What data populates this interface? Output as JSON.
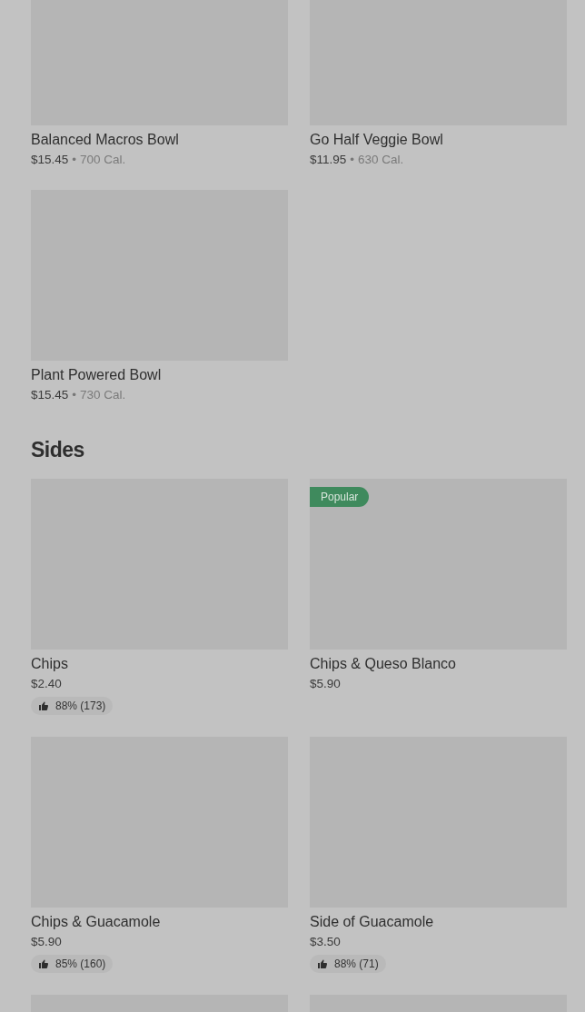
{
  "sections": [
    {
      "rows": [
        {
          "items": [
            {
              "kind": "item",
              "name": "Balanced Macros Bowl",
              "price": "$15.45",
              "separator": "•",
              "calories": "700 Cal."
            },
            {
              "kind": "item",
              "name": "Go Half Veggie Bowl",
              "price": "$11.95",
              "separator": "•",
              "calories": "630 Cal."
            }
          ]
        },
        {
          "items": [
            {
              "kind": "item",
              "name": "Plant Powered Bowl",
              "price": "$15.45",
              "separator": "•",
              "calories": "730 Cal."
            }
          ]
        }
      ]
    },
    {
      "title": "Sides",
      "rows": [
        {
          "items": [
            {
              "kind": "item",
              "name": "Chips",
              "price": "$2.40",
              "rating": "88% (173)"
            },
            {
              "kind": "item",
              "name": "Chips & Queso Blanco",
              "price": "$5.90",
              "badge": "Popular"
            }
          ]
        },
        {
          "items": [
            {
              "kind": "item",
              "name": "Chips & Guacamole",
              "price": "$5.90",
              "rating": "85% (160)"
            },
            {
              "kind": "item",
              "name": "Side of Guacamole",
              "price": "$3.50",
              "rating": "88% (71)"
            }
          ]
        },
        {
          "items": [
            {
              "kind": "image_only"
            },
            {
              "kind": "image_only"
            }
          ]
        }
      ]
    }
  ]
}
